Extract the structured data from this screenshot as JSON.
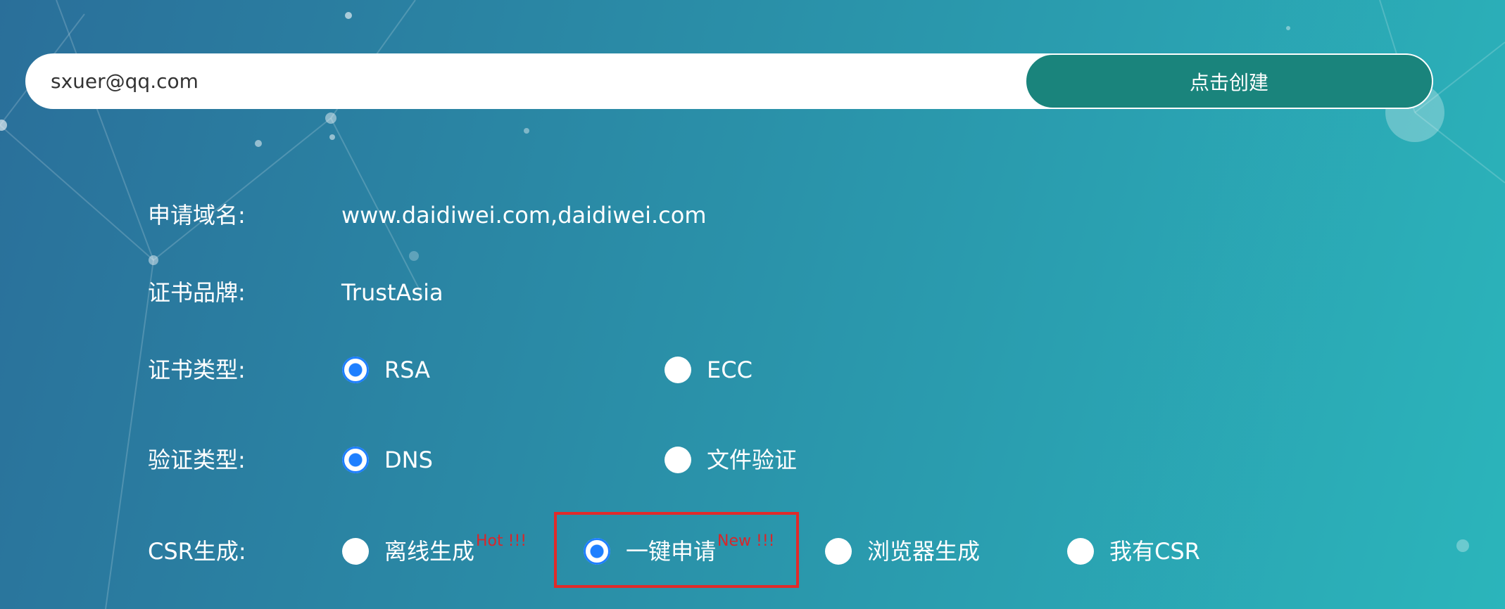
{
  "email_form": {
    "email_value": "sxuer@qq.com",
    "create_button_label": "点击创建"
  },
  "fields": {
    "domain": {
      "label": "申请域名:",
      "value": "www.daidiwei.com,daidiwei.com"
    },
    "brand": {
      "label": "证书品牌:",
      "value": "TrustAsia"
    },
    "cert_type": {
      "label": "证书类型:",
      "options": [
        {
          "label": "RSA",
          "selected": true
        },
        {
          "label": "ECC",
          "selected": false
        }
      ]
    },
    "validation_type": {
      "label": "验证类型:",
      "options": [
        {
          "label": "DNS",
          "selected": true
        },
        {
          "label": "文件验证",
          "selected": false
        }
      ]
    },
    "csr": {
      "label": "CSR生成:",
      "options": [
        {
          "label": "离线生成",
          "tag": "Hot !!!",
          "selected": false
        },
        {
          "label": "一键申请",
          "tag": "New !!!",
          "selected": true
        },
        {
          "label": "浏览器生成",
          "tag": "",
          "selected": false
        },
        {
          "label": "我有CSR",
          "tag": "",
          "selected": false
        }
      ]
    }
  },
  "colors": {
    "button_bg": "#1a847c",
    "radio_checked": "#1e7fff",
    "tag_red": "#d8262a",
    "highlight_border": "#e02a2a"
  }
}
